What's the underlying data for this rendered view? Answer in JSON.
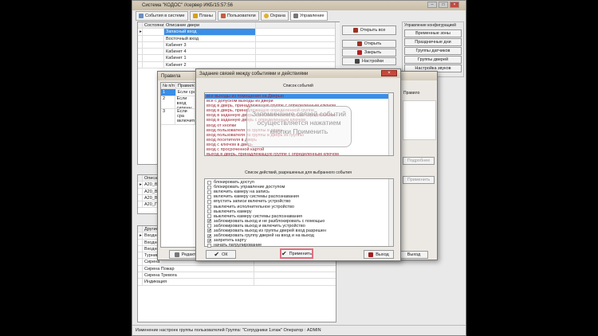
{
  "window": {
    "title": "Система \"КОДОС\" //сервер ИКБ/15:57:56"
  },
  "tabs": [
    {
      "label": "События в системе"
    },
    {
      "label": "Планы"
    },
    {
      "label": "Пользователи"
    },
    {
      "label": "Охрана"
    },
    {
      "label": "Управление"
    }
  ],
  "doors": {
    "headers": [
      "Состояние",
      "Описание двери"
    ],
    "rows": [
      "Запасный вход",
      "Восточный вход",
      "Кабинет 3",
      "Кабинет 4",
      "Кабинет 1",
      "Кабинет 2"
    ]
  },
  "door_buttons": {
    "open_all": "Открыть все",
    "open": "Открыть",
    "close": "Закрыть",
    "settings": "Настройки"
  },
  "config": {
    "title": "Управление конфигурацией",
    "items": [
      "Временные зоны",
      "Праздничные дни",
      "Группы датчиков",
      "Группы дверей",
      "Настройка звуков"
    ]
  },
  "outputs": {
    "header": "Описание",
    "rows": [
      "A20_Вых",
      "A20_Вых",
      "A20_Вых",
      "A20_Пр",
      "A20_Пр"
    ]
  },
  "others": {
    "header": "Другие",
    "rows": [
      "Входной",
      "Входной",
      "Входной",
      "Турникет",
      "Сирена",
      "Сирена Пожар",
      "Сирена Тревога",
      "Индикация"
    ]
  },
  "rules": {
    "title": "Правила",
    "headers": [
      "№ п/п",
      "Правило"
    ],
    "rows": [
      {
        "n": "1",
        "text": "Если сра"
      },
      {
        "n": "2",
        "text": "Если вход\nсирены \""
      },
      {
        "n": "3",
        "text": "Если сра\nвключить\nвключени"
      }
    ],
    "edit": "Редакт",
    "label": "Правило",
    "details": "Подробнее",
    "apply": "Применить",
    "exit": "Выход"
  },
  "dialog": {
    "title": "Задание связей между событиями и действиями",
    "events_label": "Список событий",
    "events": [
      "все выходы из помещения на Дверью",
      "все с допуском выходы из двери",
      "вход в дверь, принадлежащую группе с определенным ключом",
      "вход в дверь, принадлежащую определенной группе",
      "вход в заданную дверь с любым ключом, кроме определенного",
      "вход в заданную дверь с определенным ключом",
      "вход от кнопки",
      "вход пользователя из группы в дверь",
      "вход пользователя из группы в дверь из группы",
      "вход посетителя в дверь",
      "вход с ключом в дверь",
      "вход с просроченной картой",
      "выход в дверь, принадлежащую группе с определенным ключом"
    ],
    "actions_label": "Список действий, разрешенных для выбранного события",
    "actions": [
      {
        "t": "блокировать доступ",
        "c": false
      },
      {
        "t": "блокировать управление доступом",
        "c": false
      },
      {
        "t": "включить камеру на запись",
        "c": false
      },
      {
        "t": "включить камеру системы распознавания",
        "c": false
      },
      {
        "t": "впустить записи включить устройство",
        "c": false
      },
      {
        "t": "выключить исполнительное устройство",
        "c": false
      },
      {
        "t": "выключить камеру",
        "c": false
      },
      {
        "t": "выключить камеру системы распознавания",
        "c": false
      },
      {
        "t": "заблокировать выход и не разблокировать с помощью",
        "c": true
      },
      {
        "t": "заблокировать выход и включить устройство",
        "c": false
      },
      {
        "t": "заблокировать выход из группы дверей вход разрешен",
        "c": true
      },
      {
        "t": "заблокировать группу дверей на вход и на выход",
        "c": true
      },
      {
        "t": "запретить карту",
        "c": true
      },
      {
        "t": "начать патрулирование",
        "c": false
      }
    ],
    "ok": "ОК",
    "apply": "Применить",
    "exit": "Выход",
    "tooltip": "Запоминание связей событий осуществляется нажатием кнопки Применить"
  },
  "status": {
    "text": "Изменение настроек группы пользователей Группа: \"Сотрудники 1этаж\" Оператор : ADMIN"
  }
}
